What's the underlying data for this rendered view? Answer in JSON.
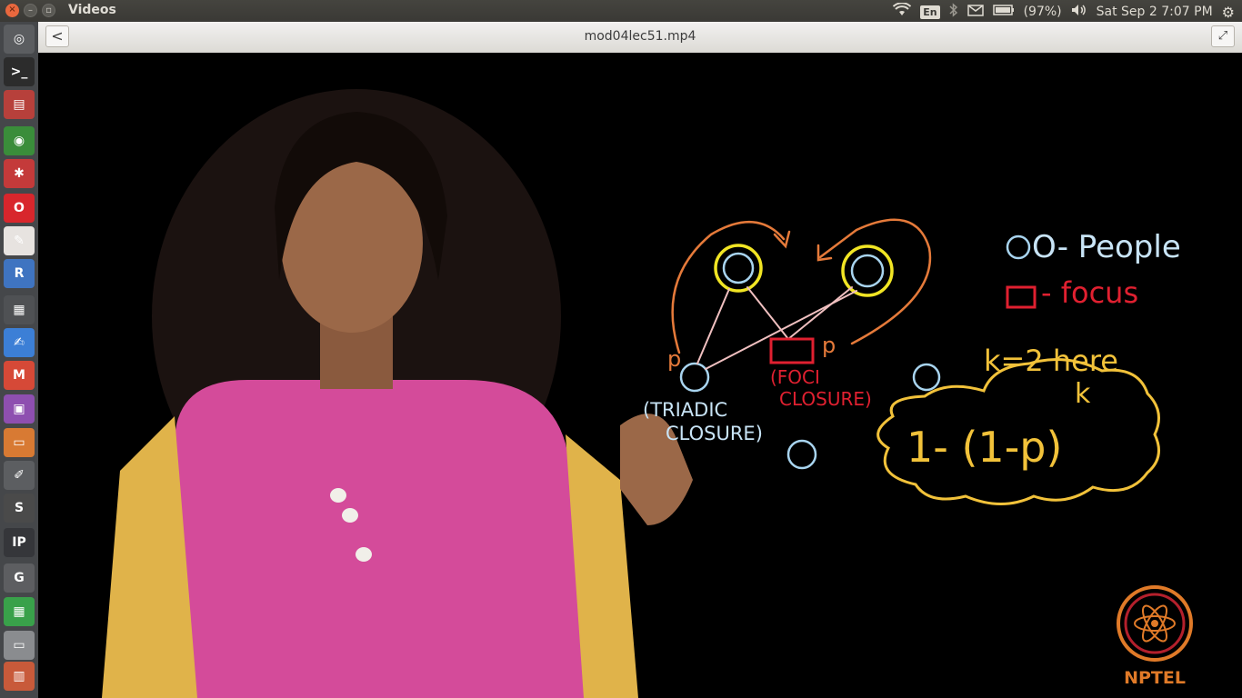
{
  "topbar": {
    "app_title": "Videos",
    "keyboard_layout": "En",
    "battery": "(97%)",
    "clock": "Sat Sep  2  7:07 PM",
    "window_buttons": [
      "×",
      "–",
      "▫"
    ]
  },
  "titlebar": {
    "file_name": "mod04lec51.mp4",
    "back_label": "<",
    "fullscreen_label": "⤢"
  },
  "launcher": {
    "items": [
      {
        "name": "dash-home-icon",
        "glyph": "◎",
        "color": "#5b5d60"
      },
      {
        "name": "terminal-icon",
        "glyph": ">_",
        "color": "#2c2c2c"
      },
      {
        "name": "archive-icon",
        "glyph": "▤",
        "color": "#b7403b"
      },
      {
        "name": "chrome-icon",
        "glyph": "◉",
        "color": "#3a8d3a"
      },
      {
        "name": "settings-app-icon",
        "glyph": "✱",
        "color": "#c43a3a"
      },
      {
        "name": "opera-icon",
        "glyph": "O",
        "color": "#d8262c"
      },
      {
        "name": "document-viewer-icon",
        "glyph": "✎",
        "color": "#e7e3e0"
      },
      {
        "name": "r-studio-icon",
        "glyph": "R",
        "color": "#3f74c1"
      },
      {
        "name": "video-editor-icon",
        "glyph": "▦",
        "color": "#4f5154"
      },
      {
        "name": "writer-icon",
        "glyph": "✍",
        "color": "#3c7fd6"
      },
      {
        "name": "gmail-icon",
        "glyph": "M",
        "color": "#d64937"
      },
      {
        "name": "screen-recorder-icon",
        "glyph": "▣",
        "color": "#8e4fb0"
      },
      {
        "name": "impress-icon",
        "glyph": "▭",
        "color": "#d87a33"
      },
      {
        "name": "text-editor-icon",
        "glyph": "✐",
        "color": "#5c5e61"
      },
      {
        "name": "sublime-icon",
        "glyph": "S",
        "color": "#4a4a4a"
      },
      {
        "name": "ipython-icon",
        "glyph": "IP",
        "color": "#35363a"
      },
      {
        "name": "gephi-icon",
        "glyph": "G",
        "color": "#5d5e61"
      },
      {
        "name": "calc-icon",
        "glyph": "▦",
        "color": "#39a14a"
      },
      {
        "name": "drive-icon",
        "glyph": "▭",
        "color": "#8a8c8f"
      },
      {
        "name": "extra-app-icon",
        "glyph": "▥",
        "color": "#c85a3a"
      }
    ]
  },
  "board": {
    "legend_people": "O- People",
    "legend_focus": "- focus",
    "k_note": "k=2 here",
    "formula": "1- (1-p)",
    "formula_exp": "k",
    "triadic_label": "(TRIADIC",
    "triadic_label2": "CLOSURE)",
    "foci_label": "(FOCI",
    "foci_label2": "CLOSURE)",
    "p_left": "p",
    "p_right": "p"
  },
  "logo": {
    "text": "NPTEL"
  }
}
